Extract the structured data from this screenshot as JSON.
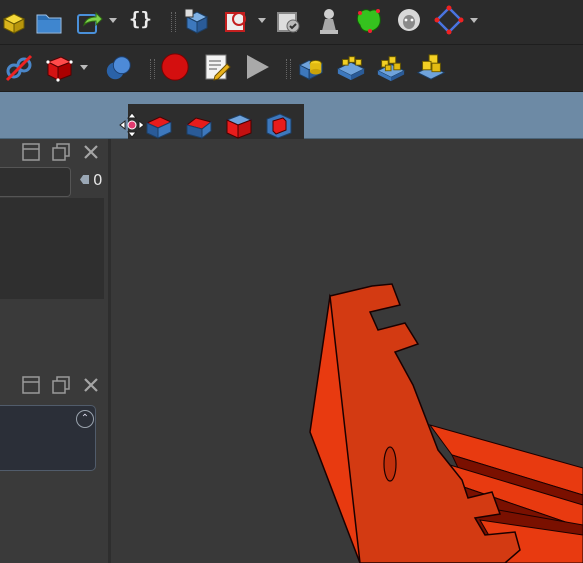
{
  "window": {
    "title": ""
  },
  "toolbar_row1": [
    {
      "name": "parts-icon"
    },
    {
      "name": "open-folder-icon"
    },
    {
      "name": "macro-export-icon",
      "dropdown": true
    },
    {
      "name": "curly-braces-icon",
      "glyph": "{}"
    },
    {
      "name": "part-design-body-icon"
    },
    {
      "name": "sketch-icon",
      "dropdown": true
    },
    {
      "name": "validate-sketch-icon"
    },
    {
      "name": "pawn-icon"
    },
    {
      "name": "green-shape-icon"
    },
    {
      "name": "sheep-icon"
    },
    {
      "name": "polygon-sketch-icon",
      "dropdown": true
    }
  ],
  "toolbar_row2": [
    {
      "name": "no-dependency-icon"
    },
    {
      "name": "red-cube-icon",
      "dropdown": true
    },
    {
      "name": "boolean-spheres-icon"
    },
    {
      "name": "record-macro-icon"
    },
    {
      "name": "macro-editor-icon"
    },
    {
      "name": "run-macro-icon"
    },
    {
      "name": "assembly-import-icon"
    },
    {
      "name": "assembly-array-icon"
    },
    {
      "name": "assembly-blocks-icon"
    },
    {
      "name": "assembly-stack-icon"
    }
  ],
  "floating_toolbar": [
    {
      "name": "move-handle-icon"
    },
    {
      "name": "fillet-icon"
    },
    {
      "name": "chamfer-icon"
    },
    {
      "name": "draft-icon"
    },
    {
      "name": "thickness-icon"
    }
  ],
  "tree_panel": {
    "counter": "0"
  },
  "colors": {
    "accent_blue": "#6d8aa5",
    "part_red": "#e83a10",
    "part_dark": "#7a1000"
  }
}
